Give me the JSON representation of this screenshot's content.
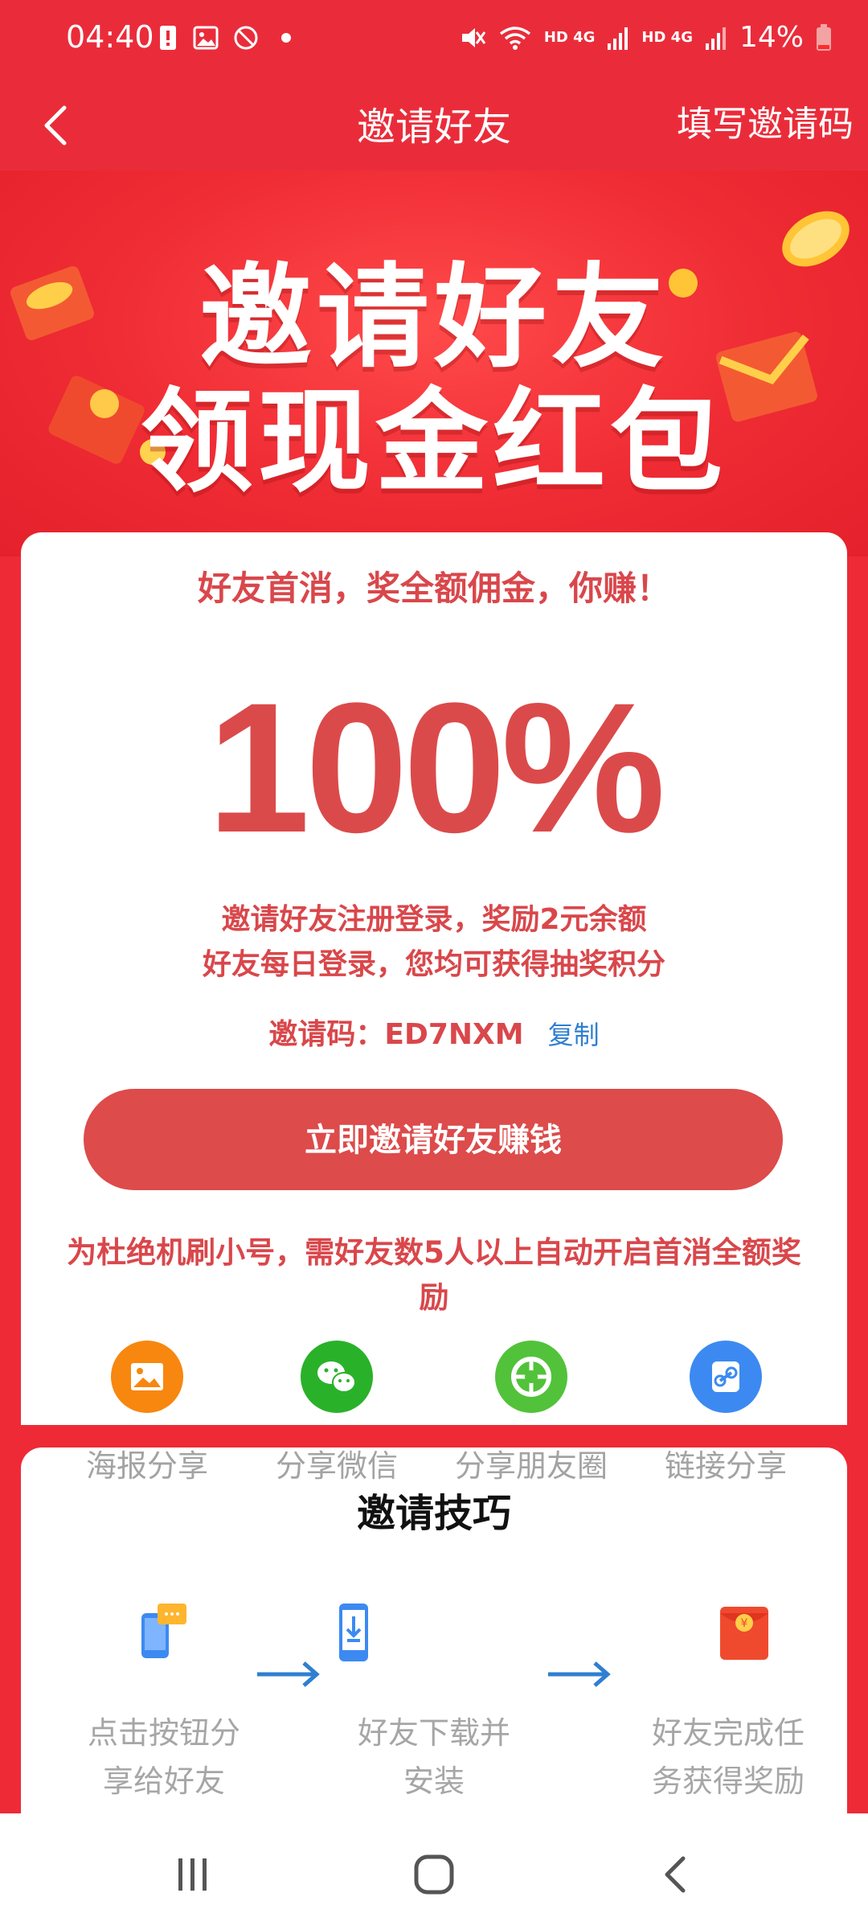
{
  "status_bar": {
    "time": "04:40",
    "battery": "14%",
    "icons": [
      "alert-icon",
      "image-icon",
      "blocked-icon",
      "dot-icon",
      "mute-icon",
      "wifi-icon",
      "signal-icon",
      "signal-icon",
      "battery-icon"
    ],
    "net1": "HD 4G",
    "net2": "HD 4G"
  },
  "nav": {
    "title": "邀请好友",
    "right_action": "填写邀请码"
  },
  "hero": {
    "line1": "邀请好友",
    "line2": "领现金红包"
  },
  "card": {
    "headline": "好友首消，奖全额佣金，你赚！",
    "percent": "100%",
    "reward_line1": "邀请好友注册登录，奖励2元余额",
    "reward_line2": "好友每日登录，您均可获得抽奖积分",
    "code_label": "邀请码：",
    "code_value": "ED7NXM",
    "copy_label": "复制",
    "invite_button": "立即邀请好友赚钱",
    "notice": "为杜绝机刷小号，需好友数5人以上自动开启首消全额奖励"
  },
  "share": {
    "items": [
      {
        "label": "海报分享",
        "color": "#f7870f",
        "icon": "poster-icon"
      },
      {
        "label": "分享微信",
        "color": "#2ab12a",
        "icon": "wechat-icon"
      },
      {
        "label": "分享朋友圈",
        "color": "#52c23a",
        "icon": "moments-icon"
      },
      {
        "label": "链接分享",
        "color": "#3c8af1",
        "icon": "link-icon"
      }
    ]
  },
  "tips": {
    "title": "邀请技巧",
    "steps": [
      {
        "line1": "点击按钮分",
        "line2": "享给好友",
        "icon": "share-phone-icon"
      },
      {
        "line1": "好友下载并",
        "line2": "安装",
        "icon": "download-phone-icon"
      },
      {
        "line1": "好友完成任",
        "line2": "务获得奖励",
        "icon": "red-envelope-icon"
      }
    ]
  },
  "colors": {
    "primary_red": "#ea2c3a",
    "text_red": "#d9474b",
    "button_red": "#dd4b4b",
    "link_blue": "#2f7fd0"
  }
}
